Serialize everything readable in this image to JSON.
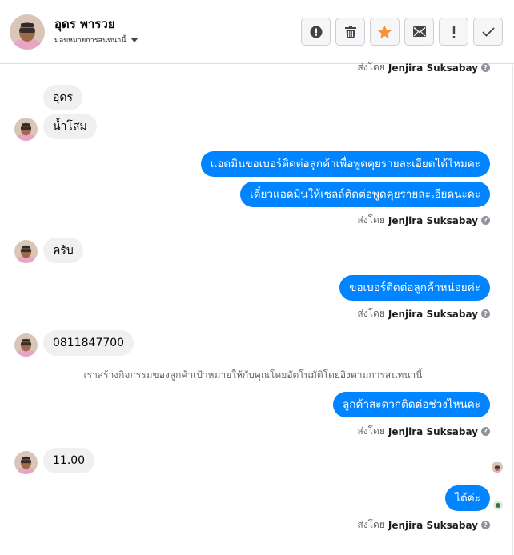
{
  "header": {
    "contact_name": "อุดร พารวย",
    "assign_label": "มอบหมายการสนทนานี้",
    "actions": [
      {
        "name": "spam",
        "icon": "alert-circle-icon"
      },
      {
        "name": "delete",
        "icon": "trash-icon"
      },
      {
        "name": "star",
        "icon": "star-icon"
      },
      {
        "name": "mark-unread",
        "icon": "envelope-icon"
      },
      {
        "name": "follow-up",
        "icon": "exclamation-icon"
      },
      {
        "name": "mark-done",
        "icon": "check-icon"
      }
    ],
    "colors": {
      "star": "#f7923b",
      "border": "#ccd0d5"
    }
  },
  "thread": {
    "sent_by_prefix": "ส่งโดย",
    "sender_name": "Jenjira Suksabay",
    "messages": [
      {
        "from": "customer",
        "text": "อุดร"
      },
      {
        "from": "customer",
        "text": "น้ำโสม"
      },
      {
        "from": "page",
        "text": "แอดมินขอเบอร์ติดต่อลูกค้าเพื่อพูดคุยรายละเอียดได้ไหมคะ"
      },
      {
        "from": "page",
        "text": "เดี๋ยวแอดมินให้เซลล์ติดต่อพูดคุยรายละเอียดนะคะ"
      },
      {
        "from": "customer",
        "text": "ครับ"
      },
      {
        "from": "page",
        "text": "ขอเบอร์ติดต่อลูกค้าหน่อยค่ะ"
      },
      {
        "from": "customer",
        "text": "0811847700"
      },
      {
        "from": "page",
        "text": "ลูกค้าสะดวกติดต่อช่วงไหนคะ"
      },
      {
        "from": "customer",
        "text": "11.00"
      },
      {
        "from": "page",
        "text": "ได้ค่ะ"
      }
    ],
    "system_note": "เราสร้างกิจกรรมของลูกค้าเป้าหมายให้กับคุณโดยอัตโนมัติโดยอิงตามการสนทนานี้",
    "colors": {
      "outgoing": "#0084ff",
      "incoming": "#f0f0f0"
    }
  }
}
